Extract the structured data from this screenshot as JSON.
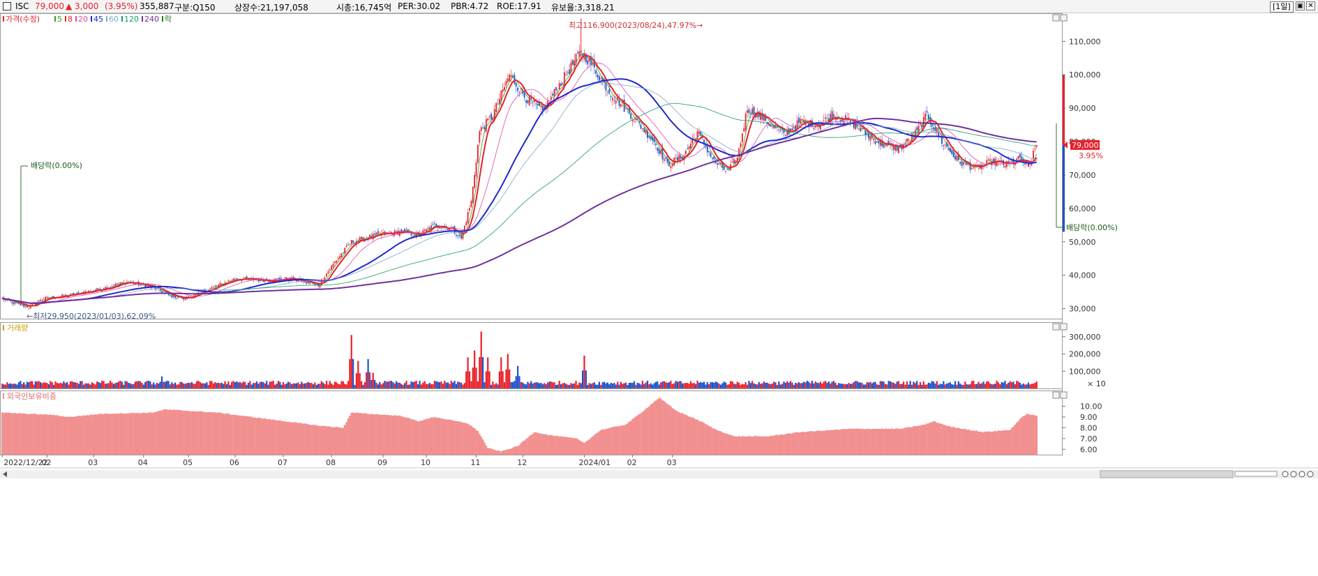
{
  "header": {
    "ticker": "ISC",
    "price": "79,000",
    "change": "▲ 3,000",
    "change_pct": "(3.95%)",
    "volume": "355,887",
    "market": "구분:Q150",
    "shares": "상장수:21,197,058",
    "market_cap": "시총:16,745억",
    "per": "PER:30.02",
    "pbr": "PBR:4.72",
    "roe": "ROE:17.91",
    "reserve": "유보율:3,318.21",
    "period": "[1일]",
    "colors": {
      "up": "#e8202a",
      "down": "#1e50c8"
    }
  },
  "price_panel": {
    "legend": [
      {
        "label": "가격(수정)",
        "color": "#e8202a"
      },
      {
        "label": "5",
        "color": "#2ca02c"
      },
      {
        "label": "8",
        "color": "#e8202a"
      },
      {
        "label": "20",
        "color": "#d94aa8"
      },
      {
        "label": "45",
        "color": "#1e28c8"
      },
      {
        "label": "60",
        "color": "#7aa8c8"
      },
      {
        "label": "120",
        "color": "#1a9a6a"
      },
      {
        "label": "240",
        "color": "#7030a0"
      },
      {
        "label": "락",
        "color": "#2a7a2a"
      }
    ],
    "y_ticks": [
      "110,000",
      "100,000",
      "90,000",
      "80,000",
      "70,000",
      "60,000",
      "50,000",
      "40,000",
      "30,000"
    ],
    "high_label": "최고116,900(2023/08/24),47.97%→",
    "low_label": "←최저29,950(2023/01/03),62.09%",
    "dividend_labels": [
      "배당락(0.00%)",
      "배당락(0.00%)"
    ],
    "last_price": "79,000",
    "last_pct": "3.95%"
  },
  "volume_panel": {
    "title": "거래량",
    "y_ticks": [
      "300,000",
      "200,000",
      "100,000"
    ],
    "unit": "× 10"
  },
  "foreign_panel": {
    "title": "외국인보유비중",
    "y_ticks": [
      "10.00",
      "9.00",
      "8.00",
      "7.00",
      "6.00"
    ]
  },
  "x_ticks": [
    "2022/12/22",
    "02",
    "03",
    "04",
    "05",
    "06",
    "07",
    "08",
    "09",
    "10",
    "11",
    "12",
    "2024/01",
    "02",
    "03"
  ],
  "chart_data": {
    "type": "candlestick",
    "title": "ISC",
    "x_range": [
      "2022/12/22",
      "2024/03"
    ],
    "price_ylim": [
      27000,
      118000
    ],
    "price_path": [
      [
        0,
        33000
      ],
      [
        8,
        31500
      ],
      [
        16,
        30500
      ],
      [
        25,
        33000
      ],
      [
        40,
        34000
      ],
      [
        60,
        36000
      ],
      [
        75,
        38000
      ],
      [
        90,
        36500
      ],
      [
        100,
        34000
      ],
      [
        110,
        33000
      ],
      [
        125,
        36000
      ],
      [
        140,
        39000
      ],
      [
        160,
        38500
      ],
      [
        175,
        39000
      ],
      [
        190,
        37000
      ],
      [
        200,
        44000
      ],
      [
        210,
        50000
      ],
      [
        225,
        52000
      ],
      [
        240,
        53000
      ],
      [
        250,
        52000
      ],
      [
        260,
        55000
      ],
      [
        270,
        54000
      ],
      [
        276,
        51000
      ],
      [
        282,
        62000
      ],
      [
        287,
        83000
      ],
      [
        295,
        88000
      ],
      [
        305,
        100000
      ],
      [
        315,
        93000
      ],
      [
        325,
        89000
      ],
      [
        335,
        97000
      ],
      [
        348,
        107000
      ],
      [
        353,
        104000
      ],
      [
        365,
        95000
      ],
      [
        378,
        88000
      ],
      [
        392,
        80000
      ],
      [
        400,
        73000
      ],
      [
        410,
        76000
      ],
      [
        418,
        83000
      ],
      [
        428,
        74000
      ],
      [
        436,
        71000
      ],
      [
        442,
        75000
      ],
      [
        448,
        90000
      ],
      [
        458,
        87000
      ],
      [
        470,
        82000
      ],
      [
        480,
        86000
      ],
      [
        490,
        85000
      ],
      [
        500,
        88000
      ],
      [
        510,
        86000
      ],
      [
        520,
        82000
      ],
      [
        530,
        79000
      ],
      [
        540,
        78000
      ],
      [
        550,
        83000
      ],
      [
        556,
        88000
      ],
      [
        565,
        80000
      ],
      [
        575,
        74000
      ],
      [
        585,
        72000
      ],
      [
        595,
        74000
      ],
      [
        605,
        73000
      ],
      [
        612,
        75000
      ],
      [
        617,
        72000
      ],
      [
        622,
        79000
      ]
    ],
    "ma_periods": [
      5,
      8,
      20,
      45,
      60,
      120,
      240
    ],
    "volume_ylim": [
      0,
      360000
    ],
    "volume_spikes": [
      [
        96,
        70000
      ],
      [
        210,
        310000
      ],
      [
        214,
        160000
      ],
      [
        220,
        170000
      ],
      [
        223,
        90000
      ],
      [
        280,
        180000
      ],
      [
        284,
        220000
      ],
      [
        288,
        330000
      ],
      [
        292,
        180000
      ],
      [
        300,
        180000
      ],
      [
        304,
        200000
      ],
      [
        310,
        130000
      ],
      [
        350,
        190000
      ],
      [
        480,
        30000
      ],
      [
        560,
        40000
      ],
      [
        590,
        40000
      ]
    ],
    "foreign_ylim": [
      5.5,
      11.2
    ],
    "foreign_path": [
      [
        0,
        9.4
      ],
      [
        30,
        9.2
      ],
      [
        40,
        9.0
      ],
      [
        60,
        9.3
      ],
      [
        90,
        9.4
      ],
      [
        98,
        9.7
      ],
      [
        130,
        9.4
      ],
      [
        150,
        9.0
      ],
      [
        170,
        8.6
      ],
      [
        190,
        8.2
      ],
      [
        205,
        8.0
      ],
      [
        210,
        9.4
      ],
      [
        240,
        9.1
      ],
      [
        250,
        8.6
      ],
      [
        260,
        9.0
      ],
      [
        280,
        8.4
      ],
      [
        286,
        7.7
      ],
      [
        292,
        6.1
      ],
      [
        300,
        5.8
      ],
      [
        310,
        6.3
      ],
      [
        320,
        7.6
      ],
      [
        330,
        7.3
      ],
      [
        345,
        7.0
      ],
      [
        350,
        6.6
      ],
      [
        360,
        7.8
      ],
      [
        375,
        8.3
      ],
      [
        385,
        9.5
      ],
      [
        395,
        10.8
      ],
      [
        405,
        9.6
      ],
      [
        420,
        8.6
      ],
      [
        428,
        7.9
      ],
      [
        440,
        7.2
      ],
      [
        460,
        7.2
      ],
      [
        480,
        7.6
      ],
      [
        510,
        7.9
      ],
      [
        540,
        7.9
      ],
      [
        555,
        8.3
      ],
      [
        560,
        8.6
      ],
      [
        570,
        8.1
      ],
      [
        590,
        7.6
      ],
      [
        606,
        7.8
      ],
      [
        612,
        8.8
      ],
      [
        616,
        9.3
      ],
      [
        622,
        9.1
      ]
    ]
  }
}
